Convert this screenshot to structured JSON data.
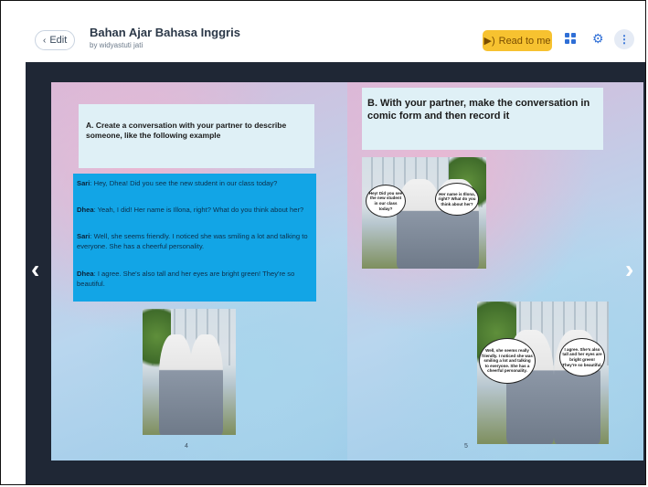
{
  "header": {
    "edit_label": "Edit",
    "title": "Bahan Ajar Bahasa Inggris",
    "author": "by widyastuti jati",
    "read_label": "Read to me",
    "accent": "#2f6fd6",
    "read_color": "#f7c230"
  },
  "icons": {
    "back": "chevron-left-icon",
    "speaker": "speaker-icon",
    "pages": "grid-icon",
    "settings": "gear-icon",
    "more": "more-vertical-icon",
    "prev": "chevron-left-icon",
    "next": "chevron-right-icon"
  },
  "left_page": {
    "instruction": "A. Create a conversation with your partner to describe someone, like the following example",
    "dialog": [
      {
        "speaker": "Sari",
        "text": "Hey, Dhea! Did you see the new student in our class today?"
      },
      {
        "speaker": "Dhea",
        "text": "Yeah, I did! Her name is Illona, right? What do you think about her?"
      },
      {
        "speaker": "Sari",
        "text": "Well, she seems friendly. I noticed she was smiling a lot and talking to everyone. She has a cheerful personality."
      },
      {
        "speaker": "Dhea",
        "text": "I agree. She's also tall and her eyes are bright green! They're so beautiful."
      }
    ],
    "page_number": "4"
  },
  "right_page": {
    "instruction": "B. With your partner, make the conversation in comic form and then record it",
    "comic1": {
      "bubble_left": "Hey! Did you see the new student in our class today?",
      "bubble_right": "Her name is Illona, right? What do you think about her?"
    },
    "comic2": {
      "bubble_left": "Well, she seems really friendly. I noticed she was smiling a lot and talking to everyone. She has a cheerful personality.",
      "bubble_right": "I agree. She's also tall and her eyes are bright green! They're so beautiful."
    },
    "page_number": "5"
  }
}
